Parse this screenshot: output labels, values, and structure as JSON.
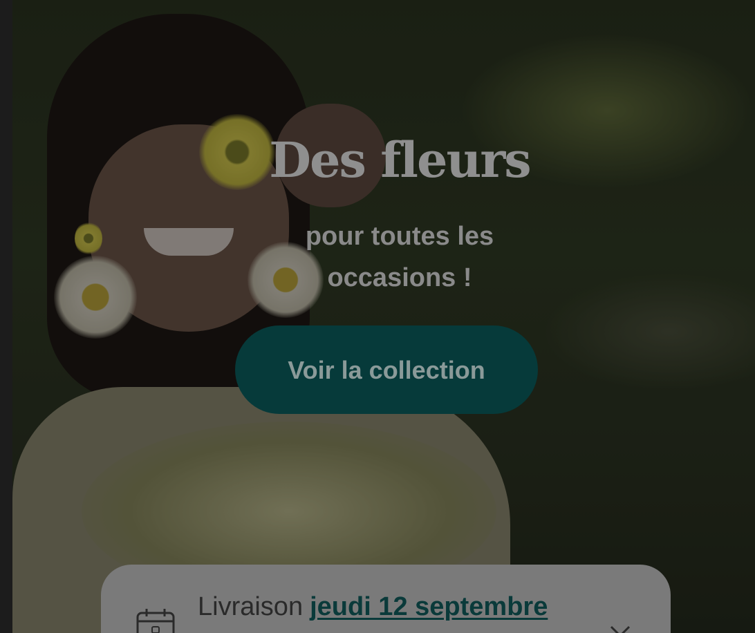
{
  "hero": {
    "headline": "Des fleurs",
    "subline": "pour toutes les occasions !",
    "cta_label": "Voir la collection"
  },
  "delivery": {
    "label": "Livraison",
    "date": "jeudi 12 septembre",
    "icon": "calendar-icon",
    "close_icon": "close-icon"
  },
  "colors": {
    "cta_background": "#063a3a",
    "date_link": "#0a3a3a",
    "overlay": "rgba(0,0,0,0.38)"
  }
}
